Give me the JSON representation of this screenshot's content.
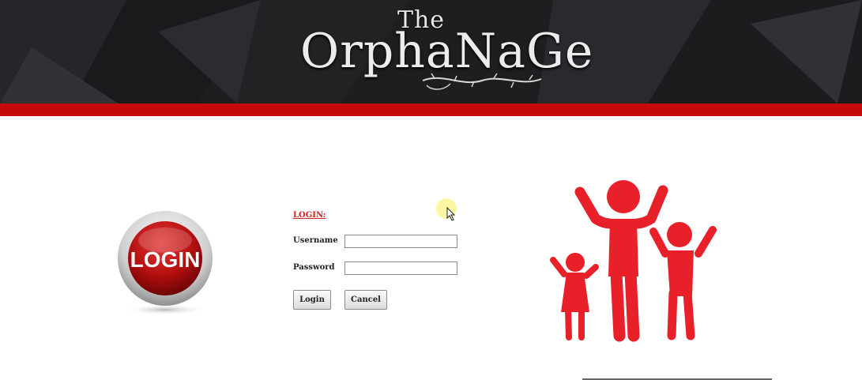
{
  "header": {
    "logo_the": "The",
    "logo_word": "OrphaNaGe"
  },
  "login_badge": {
    "label": "LOGIN"
  },
  "form": {
    "title": "LOGIN:",
    "username_label": "Username",
    "username_value": "",
    "password_label": "Password",
    "password_value": "",
    "login_button": "Login",
    "cancel_button": "Cancel"
  },
  "colors": {
    "accent_red": "#c40a0a",
    "family_icon_red": "#e8202a",
    "header_dark": "#1e1e20"
  },
  "icons": {
    "family": "family-icon",
    "cursor": "mouse-cursor-icon"
  }
}
